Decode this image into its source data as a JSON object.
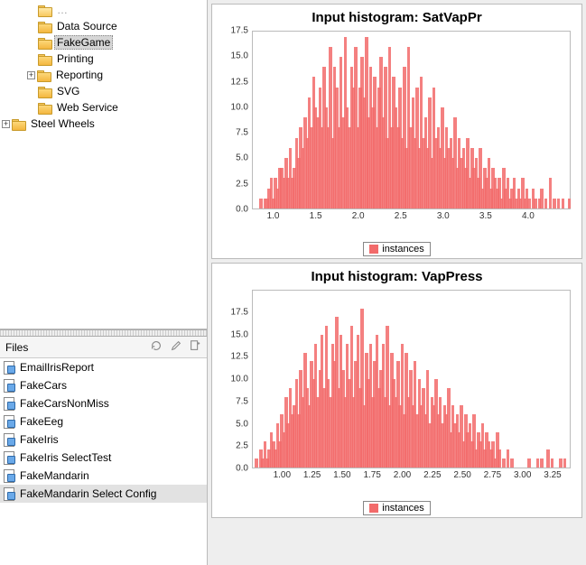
{
  "tree": {
    "items": [
      {
        "indent": 42,
        "label": "Data Source",
        "open": false
      },
      {
        "indent": 42,
        "label": "FakeGame",
        "open": false,
        "selected": true
      },
      {
        "indent": 42,
        "label": "Printing",
        "open": false
      },
      {
        "indent": 42,
        "label": "Reporting",
        "open": false,
        "expander": "+"
      },
      {
        "indent": 42,
        "label": "SVG",
        "open": false
      },
      {
        "indent": 42,
        "label": "Web Service",
        "open": false
      },
      {
        "indent": 14,
        "label": "Steel Wheels",
        "open": false,
        "expander": "+"
      }
    ]
  },
  "files": {
    "header": "Files",
    "items": [
      {
        "label": "EmailIrisReport"
      },
      {
        "label": "FakeCars"
      },
      {
        "label": "FakeCarsNonMiss"
      },
      {
        "label": "FakeEeg"
      },
      {
        "label": "FakeIris"
      },
      {
        "label": "FakeIris SelectTest"
      },
      {
        "label": "FakeMandarin"
      },
      {
        "label": "FakeMandarin Select Config",
        "selected": true
      }
    ]
  },
  "chart_data": [
    {
      "type": "bar",
      "title": "Input histogram: SatVapPr",
      "xlabel": "",
      "ylabel": "",
      "xlim": [
        0.75,
        4.5
      ],
      "ylim": [
        0,
        17.5
      ],
      "y_ticks": [
        0.0,
        2.5,
        5.0,
        7.5,
        10.0,
        12.5,
        15.0,
        17.5
      ],
      "x_ticks": [
        1.0,
        1.5,
        2.0,
        2.5,
        3.0,
        3.5,
        4.0
      ],
      "legend": "instances",
      "values": [
        0,
        0,
        0,
        1,
        0,
        1,
        1,
        2,
        3,
        1,
        3,
        2,
        4,
        4,
        3,
        5,
        3,
        6,
        3,
        4,
        7,
        5,
        8,
        6,
        9,
        7,
        11,
        8,
        13,
        10,
        9,
        12,
        8,
        14,
        10,
        8,
        16,
        7,
        14,
        12,
        8,
        15,
        9,
        17,
        10,
        8,
        14,
        12,
        16,
        8,
        12,
        15,
        11,
        17,
        9,
        14,
        10,
        13,
        8,
        12,
        15,
        9,
        14,
        7,
        16,
        8,
        13,
        10,
        8,
        12,
        7,
        14,
        6,
        16,
        8,
        11,
        7,
        12,
        6,
        13,
        7,
        9,
        6,
        11,
        5,
        12,
        7,
        8,
        6,
        10,
        5,
        8,
        6,
        7,
        5,
        9,
        4,
        7,
        5,
        6,
        4,
        7,
        3,
        6,
        4,
        5,
        3,
        6,
        2,
        4,
        3,
        5,
        2,
        4,
        3,
        2,
        3,
        1,
        4,
        2,
        3,
        1,
        2,
        3,
        1,
        2,
        1,
        3,
        1,
        2,
        1,
        0,
        2,
        1,
        0,
        1,
        2,
        0,
        1,
        0,
        3,
        0,
        1,
        0,
        1,
        0,
        1,
        0,
        0,
        1
      ]
    },
    {
      "type": "bar",
      "title": "Input histogram: VapPress",
      "xlabel": "",
      "ylabel": "",
      "xlim": [
        0.75,
        3.4
      ],
      "ylim": [
        0,
        20
      ],
      "y_ticks": [
        0.0,
        2.5,
        5.0,
        7.5,
        10.0,
        12.5,
        15.0,
        17.5
      ],
      "x_ticks": [
        1.0,
        1.25,
        1.5,
        1.75,
        2.0,
        2.25,
        2.5,
        2.75,
        3.0,
        3.25
      ],
      "legend": "instances",
      "values": [
        0,
        1,
        0,
        2,
        1,
        3,
        1,
        2,
        4,
        3,
        2,
        5,
        3,
        6,
        4,
        8,
        5,
        9,
        6,
        7,
        10,
        6,
        11,
        8,
        13,
        9,
        7,
        12,
        10,
        14,
        8,
        11,
        15,
        9,
        16,
        10,
        8,
        14,
        12,
        17,
        9,
        15,
        11,
        8,
        14,
        10,
        16,
        8,
        12,
        15,
        9,
        18,
        7,
        13,
        10,
        14,
        8,
        12,
        15,
        9,
        11,
        14,
        8,
        16,
        7,
        13,
        10,
        8,
        12,
        7,
        14,
        6,
        13,
        8,
        11,
        7,
        12,
        6,
        10,
        7,
        9,
        6,
        11,
        5,
        8,
        7,
        10,
        6,
        8,
        5,
        7,
        6,
        9,
        4,
        7,
        5,
        6,
        4,
        7,
        3,
        6,
        4,
        5,
        3,
        6,
        2,
        4,
        3,
        5,
        2,
        4,
        3,
        2,
        3,
        1,
        4,
        2,
        0,
        1,
        0,
        2,
        0,
        1,
        0,
        0,
        0,
        0,
        0,
        0,
        0,
        1,
        0,
        0,
        0,
        1,
        0,
        1,
        0,
        0,
        2,
        0,
        1,
        0,
        0,
        0,
        1,
        0,
        1,
        0,
        0
      ]
    }
  ]
}
